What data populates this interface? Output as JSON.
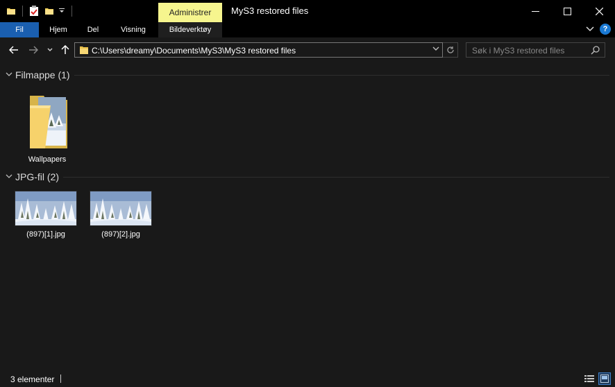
{
  "window": {
    "title": "MyS3 restored files",
    "context_tab": "Administrer",
    "minimize_glyph": "—",
    "maximize_glyph": "☐",
    "close_glyph": "✕"
  },
  "ribbon": {
    "tabs": [
      {
        "label": "Fil"
      },
      {
        "label": "Hjem"
      },
      {
        "label": "Del"
      },
      {
        "label": "Visning"
      },
      {
        "label": "Bildeverktøy"
      }
    ],
    "help_label": "?"
  },
  "navigation": {
    "address_path": "C:\\Users\\dreamy\\Documents\\MyS3\\MyS3 restored files",
    "search_placeholder": "Søk i MyS3 restored files"
  },
  "groups": [
    {
      "title": "Filmappe (1)",
      "items": [
        {
          "label": "Wallpapers",
          "kind": "folder"
        }
      ]
    },
    {
      "title": "JPG-fil (2)",
      "items": [
        {
          "label": "(897)[1].jpg",
          "kind": "image"
        },
        {
          "label": "(897)[2].jpg",
          "kind": "image"
        }
      ]
    }
  ],
  "status": {
    "item_count": "3 elementer"
  },
  "colors": {
    "file_tab": "#1a5fb0",
    "context_tab": "#f6f58e",
    "background": "#191919",
    "help": "#1a79d3"
  }
}
